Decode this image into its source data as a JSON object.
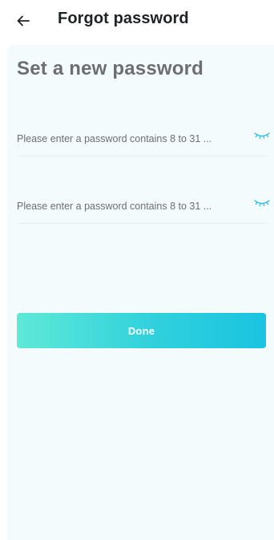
{
  "header": {
    "title": "Forgot password",
    "back_icon": "arrow-left-icon"
  },
  "main": {
    "heading": "Set a new password",
    "password_field": {
      "placeholder": "Please enter a password contains 8 to 31 ...",
      "value": "",
      "icon": "eye-closed-icon"
    },
    "confirm_field": {
      "placeholder": "Please enter a password contains 8 to 31 ...",
      "value": "",
      "icon": "eye-closed-icon"
    },
    "done_label": "Done"
  },
  "colors": {
    "accent_start": "#5ee9d7",
    "accent_end": "#1ac3e0",
    "eye_icon": "#2bbfe0",
    "content_bg": "#f4fbfc"
  }
}
